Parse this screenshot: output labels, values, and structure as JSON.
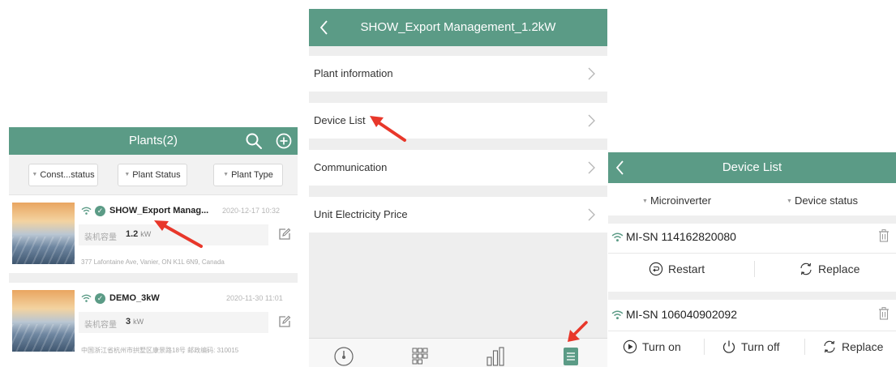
{
  "colors": {
    "accent": "#5b9b86",
    "arrow": "#e8372a"
  },
  "plants_screen": {
    "title": "Plants(2)",
    "filters": [
      "Const...status",
      "Plant Status",
      "Plant Type"
    ],
    "capacity_label": "装机容量",
    "plants": [
      {
        "name": "SHOW_Export Manag...",
        "date": "2020-12-17 10:32",
        "capacity": "1.2",
        "unit": "kW",
        "address": "377 Lafontaine Ave, Vanier, ON K1L 6N9, Canada"
      },
      {
        "name": "DEMO_3kW",
        "date": "2020-11-30 11:01",
        "capacity": "3",
        "unit": "kW",
        "address": "中国浙江省杭州市拱墅区康景路18号 邮政编码: 310015"
      }
    ]
  },
  "plant_menu_screen": {
    "title": "SHOW_Export Management_1.2kW",
    "items": [
      "Plant information",
      "Device List",
      "Communication",
      "Unit Electricity Price"
    ]
  },
  "device_list_screen": {
    "title": "Device List",
    "filter_type": "Microinverter",
    "filter_status": "Device status",
    "devices": [
      {
        "sn": "MI-SN  114162820080",
        "actions": [
          "Restart",
          "Replace"
        ]
      },
      {
        "sn": "MI-SN  106040902092",
        "actions": [
          "Turn on",
          "Turn off",
          "Replace"
        ]
      }
    ]
  }
}
